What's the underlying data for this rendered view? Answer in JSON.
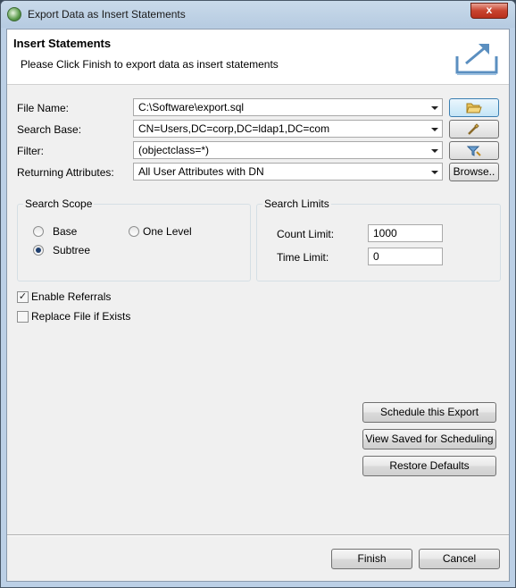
{
  "window": {
    "title": "Export Data as Insert Statements",
    "close_label": "x"
  },
  "header": {
    "title": "Insert Statements",
    "description": "Please Click Finish to export data as insert statements"
  },
  "form": {
    "file_name": {
      "label": "File Name:",
      "value": "C:\\Software\\export.sql"
    },
    "search_base": {
      "label": "Search Base:",
      "value": "CN=Users,DC=corp,DC=ldap1,DC=com"
    },
    "filter": {
      "label": "Filter:",
      "value": "(objectclass=*)"
    },
    "returning_attributes": {
      "label": "Returning Attributes:",
      "value": "All User Attributes with DN"
    },
    "browse_label": "Browse.."
  },
  "search_scope": {
    "title": "Search Scope",
    "options": [
      {
        "label": "Base",
        "checked": false
      },
      {
        "label": "One Level",
        "checked": false
      },
      {
        "label": "Subtree",
        "checked": true
      }
    ]
  },
  "search_limits": {
    "title": "Search Limits",
    "count_limit": {
      "label": "Count Limit:",
      "value": "1000"
    },
    "time_limit": {
      "label": "Time Limit:",
      "value": "0"
    }
  },
  "options": {
    "enable_referrals": {
      "label": "Enable Referrals",
      "checked": true
    },
    "replace_file": {
      "label": "Replace File if Exists",
      "checked": false
    }
  },
  "actions": {
    "schedule": "Schedule this Export",
    "view_saved": "View Saved for Scheduling",
    "restore": "Restore Defaults"
  },
  "footer": {
    "finish": "Finish",
    "cancel": "Cancel"
  }
}
